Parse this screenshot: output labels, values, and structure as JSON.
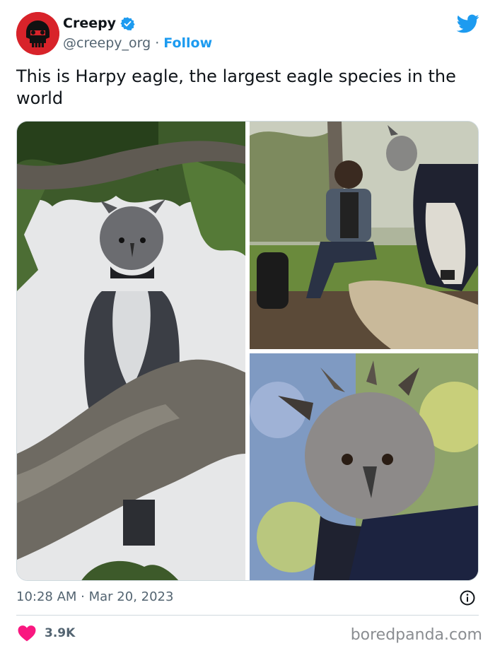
{
  "account": {
    "name": "Creepy",
    "handle": "@creepy_org",
    "separator": "·",
    "follow_label": "Follow",
    "avatar_icon": "skull-avatar-icon",
    "verified_icon": "verified-badge-icon"
  },
  "platform_icon": "twitter-bird-icon",
  "tweet": {
    "text": "This is Harpy eagle, the largest eagle species in the world"
  },
  "media": {
    "photos": [
      "harpy-eagle-perched-on-branch",
      "man-sitting-beside-harpy-eagle",
      "harpy-eagle-close-up"
    ]
  },
  "meta": {
    "timestamp": "10:28 AM · Mar 20, 2023",
    "info_icon": "info-icon"
  },
  "engagement": {
    "likes": "3.9K",
    "heart_icon": "heart-icon"
  },
  "watermark": "boredpanda.com",
  "colors": {
    "accent": "#1d9bf0",
    "heart": "#f91880",
    "avatar_bg": "#d8232a",
    "secondary_text": "#536471"
  }
}
